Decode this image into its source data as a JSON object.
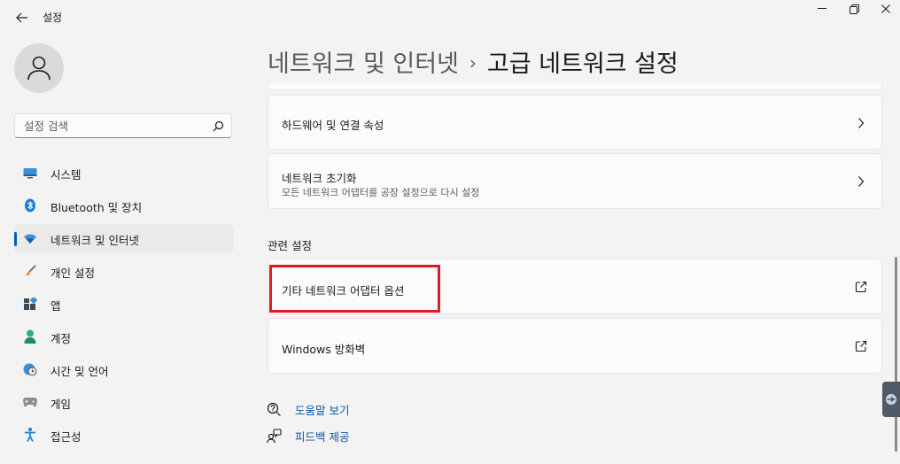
{
  "window": {
    "title": "설정"
  },
  "sidebar": {
    "search_placeholder": "설정 검색",
    "items": [
      {
        "label": "시스템",
        "icon": "monitor-icon"
      },
      {
        "label": "Bluetooth 및 장치",
        "icon": "bluetooth-icon"
      },
      {
        "label": "네트워크 및 인터넷",
        "icon": "wifi-icon",
        "selected": true
      },
      {
        "label": "개인 설정",
        "icon": "brush-icon"
      },
      {
        "label": "앱",
        "icon": "apps-icon"
      },
      {
        "label": "계정",
        "icon": "account-icon"
      },
      {
        "label": "시간 및 언어",
        "icon": "globe-clock-icon"
      },
      {
        "label": "게임",
        "icon": "gamepad-icon"
      },
      {
        "label": "접근성",
        "icon": "accessibility-icon"
      }
    ]
  },
  "breadcrumb": {
    "parent": "네트워크 및 인터넷",
    "separator": "›",
    "current": "고급 네트워크 설정"
  },
  "cards": {
    "hardware": {
      "title": "하드웨어 및 연결 속성"
    },
    "reset": {
      "title": "네트워크 초기화",
      "subtitle": "모든 네트워크 어댑터를 공장 설정으로 다시 설정"
    }
  },
  "related": {
    "section_title": "관련 설정",
    "items": [
      {
        "title": "기타 네트워크 어댑터 옵션",
        "icon": "open-external-icon"
      },
      {
        "title": "Windows 방화벽",
        "icon": "open-external-icon"
      }
    ]
  },
  "help_links": [
    {
      "label": "도움말 보기",
      "icon": "help-icon"
    },
    {
      "label": "피드백 제공",
      "icon": "feedback-icon"
    }
  ],
  "colors": {
    "accent": "#005fb8",
    "highlight": "#e01b24",
    "link": "#0a55a8"
  }
}
